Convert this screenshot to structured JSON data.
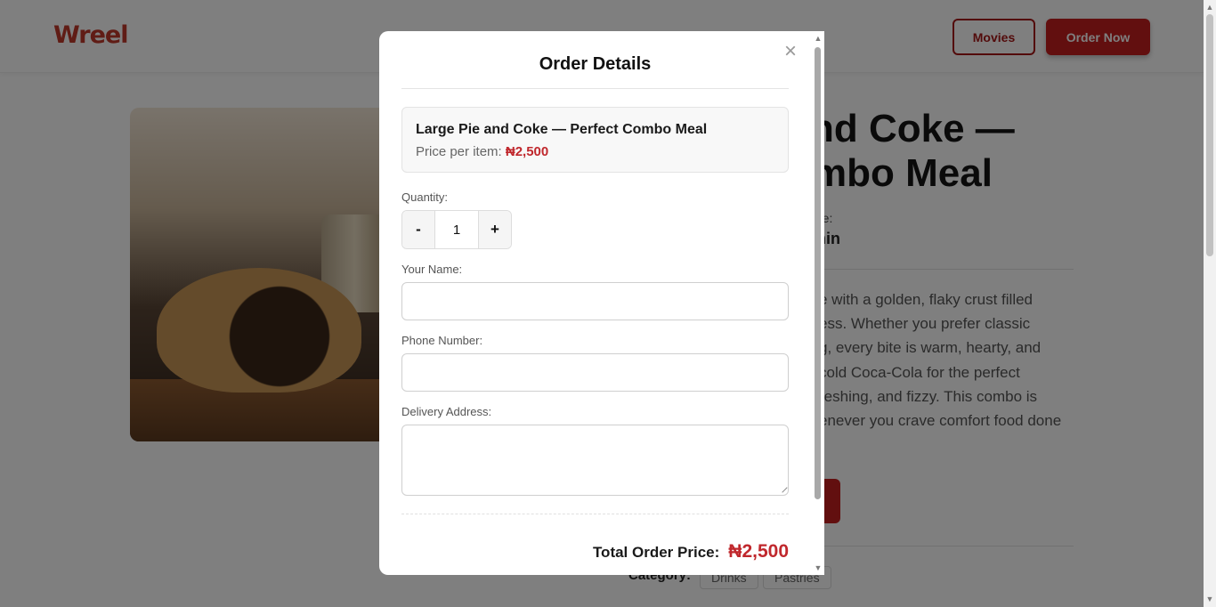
{
  "nav": {
    "logo": "Wreel",
    "movies_label": "Movies",
    "order_now_label": "Order Now"
  },
  "product_page": {
    "title_line1": "nd Coke —",
    "title_line2": "mbo Meal",
    "meta_label": "me:",
    "meta_value": "min",
    "description_lines": [
      "e with a golden, flaky crust filled",
      "ess. Whether you prefer classic",
      "g, every bite is warm, hearty, and",
      "cold Coca-Cola for the perfect",
      "reshing, and fizzy. This combo is",
      "enever you crave comfort food done"
    ],
    "category_label": "Category:",
    "categories": [
      "Drinks",
      "Pastries"
    ]
  },
  "modal": {
    "close_symbol": "×",
    "title": "Order Details",
    "item_name": "Large Pie and Coke — Perfect Combo Meal",
    "price_label": "Price per item:",
    "price_value": "₦2,500",
    "quantity_label": "Quantity:",
    "decrement_label": "-",
    "quantity_value": "1",
    "increment_label": "+",
    "name_label": "Your Name:",
    "name_value": "",
    "phone_label": "Phone Number:",
    "phone_value": "",
    "address_label": "Delivery Address:",
    "address_value": "",
    "total_label": "Total Order Price:",
    "total_value": "₦2,500"
  },
  "colors": {
    "accent_red": "#c41f1f",
    "price_red": "#c0282d"
  },
  "icons": {
    "close": "close-icon",
    "scroll_up": "scroll-up-icon",
    "scroll_down": "scroll-down-icon"
  }
}
